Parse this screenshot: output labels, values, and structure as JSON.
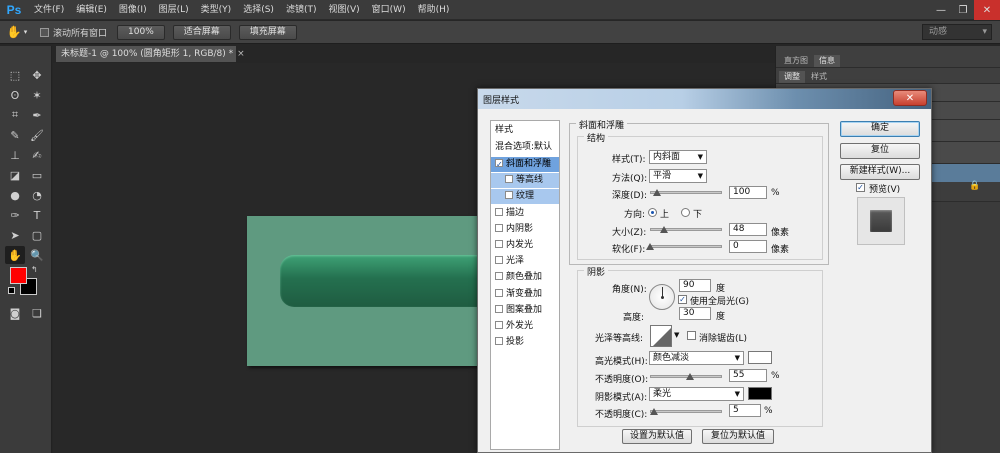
{
  "app": {
    "logo": "Ps",
    "menu": [
      "文件(F)",
      "编辑(E)",
      "图像(I)",
      "图层(L)",
      "类型(Y)",
      "选择(S)",
      "滤镜(T)",
      "视图(V)",
      "窗口(W)",
      "帮助(H)"
    ],
    "window_controls": [
      "—",
      "❐",
      "✕"
    ]
  },
  "options_bar": {
    "tool_icon": "hand-icon",
    "scroll_all_label": "滚动所有窗口",
    "zoom_100_label": "100%",
    "fit_screen_label": "适合屏幕",
    "fill_screen_label": "填充屏幕",
    "workspace_label": "动感"
  },
  "document": {
    "tab_title": "未标题-1 @ 100% (圆角矩形 1, RGB/8) *",
    "tab_close": "×",
    "canvas_color": "#5f9a80",
    "shape_color": "#24704f"
  },
  "colors": {
    "foreground": "#ff0000",
    "background": "#000000"
  },
  "right_panel": {
    "tabs_top": [
      "直方图",
      "信息"
    ],
    "tabs_second": [
      "调整",
      "样式"
    ]
  },
  "dialog": {
    "title": "图层样式",
    "close_label": "✕",
    "styles_header": "样式",
    "blend_options": "混合选项:默认",
    "styles": [
      {
        "label": "斜面和浮雕",
        "checked": true,
        "selected": true,
        "sub": false
      },
      {
        "label": "等高线",
        "checked": false,
        "selected": false,
        "sub": true
      },
      {
        "label": "纹理",
        "checked": false,
        "selected": false,
        "sub": true
      },
      {
        "label": "描边",
        "checked": false,
        "selected": false,
        "sub": false
      },
      {
        "label": "内阴影",
        "checked": false,
        "selected": false,
        "sub": false
      },
      {
        "label": "内发光",
        "checked": false,
        "selected": false,
        "sub": false
      },
      {
        "label": "光泽",
        "checked": false,
        "selected": false,
        "sub": false
      },
      {
        "label": "颜色叠加",
        "checked": false,
        "selected": false,
        "sub": false
      },
      {
        "label": "渐变叠加",
        "checked": false,
        "selected": false,
        "sub": false
      },
      {
        "label": "图案叠加",
        "checked": false,
        "selected": false,
        "sub": false
      },
      {
        "label": "外发光",
        "checked": false,
        "selected": false,
        "sub": false
      },
      {
        "label": "投影",
        "checked": false,
        "selected": false,
        "sub": false
      }
    ],
    "bevel": {
      "section_title": "斜面和浮雕",
      "structure_title": "结构",
      "style_label": "样式(T):",
      "style_value": "内斜面",
      "technique_label": "方法(Q):",
      "technique_value": "平滑",
      "depth_label": "深度(D):",
      "depth_value": "100",
      "depth_unit": "%",
      "depth_level": 0.1,
      "direction_label": "方向:",
      "direction_up": "上",
      "direction_down": "下",
      "direction_selected": "up",
      "size_label": "大小(Z):",
      "size_value": "48",
      "size_unit": "像素",
      "size_level": 0.19,
      "soften_label": "软化(F):",
      "soften_value": "0",
      "soften_unit": "像素",
      "soften_level": 0
    },
    "shading": {
      "title": "阴影",
      "angle_label": "角度(N):",
      "angle_value": "90",
      "angle_unit": "度",
      "global_light_label": "使用全局光(G)",
      "global_light_checked": true,
      "altitude_label": "高度:",
      "altitude_value": "30",
      "altitude_unit": "度",
      "gloss_contour_label": "光泽等高线:",
      "antialias_label": "消除锯齿(L)",
      "antialias_checked": false,
      "highlight_mode_label": "高光模式(H):",
      "highlight_mode_value": "颜色减淡",
      "highlight_color": "#ffffff",
      "highlight_opacity_label": "不透明度(O):",
      "highlight_opacity_value": "55",
      "highlight_opacity_level": 0.55,
      "shadow_mode_label": "阴影模式(A):",
      "shadow_mode_value": "柔光",
      "shadow_color": "#000000",
      "shadow_opacity_label": "不透明度(C):",
      "shadow_opacity_value": "5",
      "shadow_opacity_level": 0.05,
      "percent_unit": "%"
    },
    "make_default_label": "设置为默认值",
    "reset_default_label": "复位为默认值",
    "ok_label": "确定",
    "reset_label": "复位",
    "new_style_label": "新建样式(W)...",
    "preview_label": "预览(V)",
    "preview_checked": true
  }
}
